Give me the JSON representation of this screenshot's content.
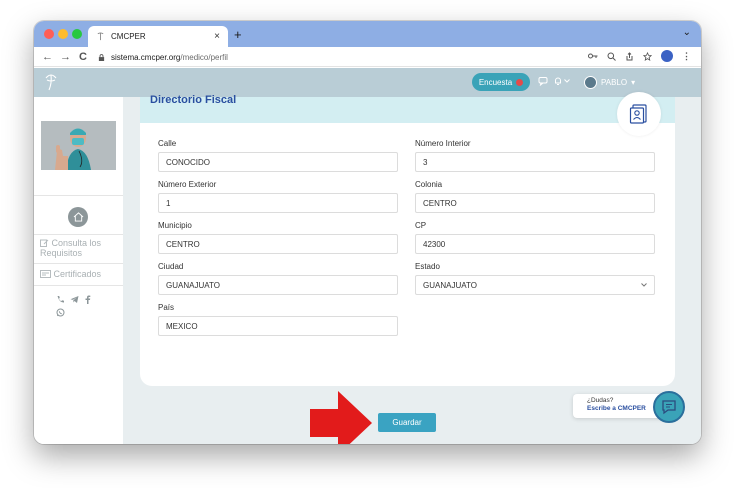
{
  "browser": {
    "tab_title": "CMCPER",
    "tab_close": "×",
    "new_tab": "+",
    "tab_menu": "⌄",
    "nav_back": "←",
    "nav_forward": "→",
    "nav_reload": "C",
    "url_host": "sistema.cmcper.org",
    "url_path": "/medico/perfil"
  },
  "appbar": {
    "survey_label": "Encuesta",
    "user_name": "PABLO",
    "user_caret": "▾"
  },
  "sidebar": {
    "consulta_label": "Consulta los Requisitos",
    "certificados_label": "Certificados"
  },
  "card": {
    "title": "Directorio Fiscal",
    "fields": {
      "calle": {
        "label": "Calle",
        "value": "CONOCIDO"
      },
      "numero_interior": {
        "label": "Número Interior",
        "value": "3"
      },
      "numero_exterior": {
        "label": "Número Exterior",
        "value": "1"
      },
      "colonia": {
        "label": "Colonia",
        "value": "CENTRO"
      },
      "municipio": {
        "label": "Municipio",
        "value": "CENTRO"
      },
      "cp": {
        "label": "CP",
        "value": "42300"
      },
      "ciudad": {
        "label": "Ciudad",
        "value": "GUANAJUATO"
      },
      "estado": {
        "label": "Estado",
        "value": "GUANAJUATO"
      },
      "pais": {
        "label": "País",
        "value": "MEXICO"
      }
    }
  },
  "actions": {
    "save_label": "Guardar"
  },
  "help": {
    "line1": "¿Dudas?",
    "line2": "Escribe a CMCPER"
  },
  "colors": {
    "accent": "#3aa3b8",
    "header_bg": "#d3eef2",
    "arrow": "#e21b1b",
    "title": "#2a4fa0"
  }
}
